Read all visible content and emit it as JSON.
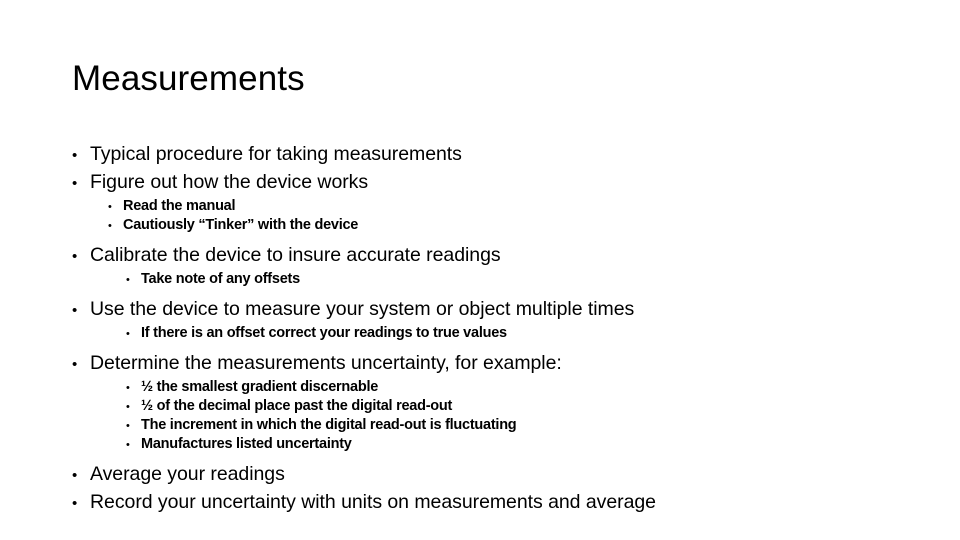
{
  "slide": {
    "title": "Measurements",
    "bullet_glyph": "•",
    "text_color": "#000000",
    "background_color": "#ffffff",
    "outline": [
      {
        "level": 1,
        "text": "Typical procedure for taking measurements"
      },
      {
        "level": 1,
        "text": "Figure out how the device works"
      },
      {
        "level": 2,
        "text": "Read the manual"
      },
      {
        "level": 2,
        "text": "Cautiously “Tinker” with the device"
      },
      {
        "level": 1,
        "text": "Calibrate the device to insure accurate readings"
      },
      {
        "level": 3,
        "text": "Take note of any offsets"
      },
      {
        "level": 1,
        "text": "Use the device to measure your system or object multiple times"
      },
      {
        "level": 3,
        "text": "If there is an offset correct your readings to true values"
      },
      {
        "level": 1,
        "text": "Determine the measurements uncertainty, for example:"
      },
      {
        "level": 3,
        "text": "½ the smallest gradient discernable"
      },
      {
        "level": 3,
        "text": "½ of the decimal place past the digital read-out"
      },
      {
        "level": 3,
        "text": "The increment in which the digital read-out is fluctuating"
      },
      {
        "level": 3,
        "text": "Manufactures listed uncertainty"
      },
      {
        "level": 1,
        "text": "Average your readings"
      },
      {
        "level": 1,
        "text": "Record your uncertainty with units on measurements and average"
      }
    ]
  }
}
